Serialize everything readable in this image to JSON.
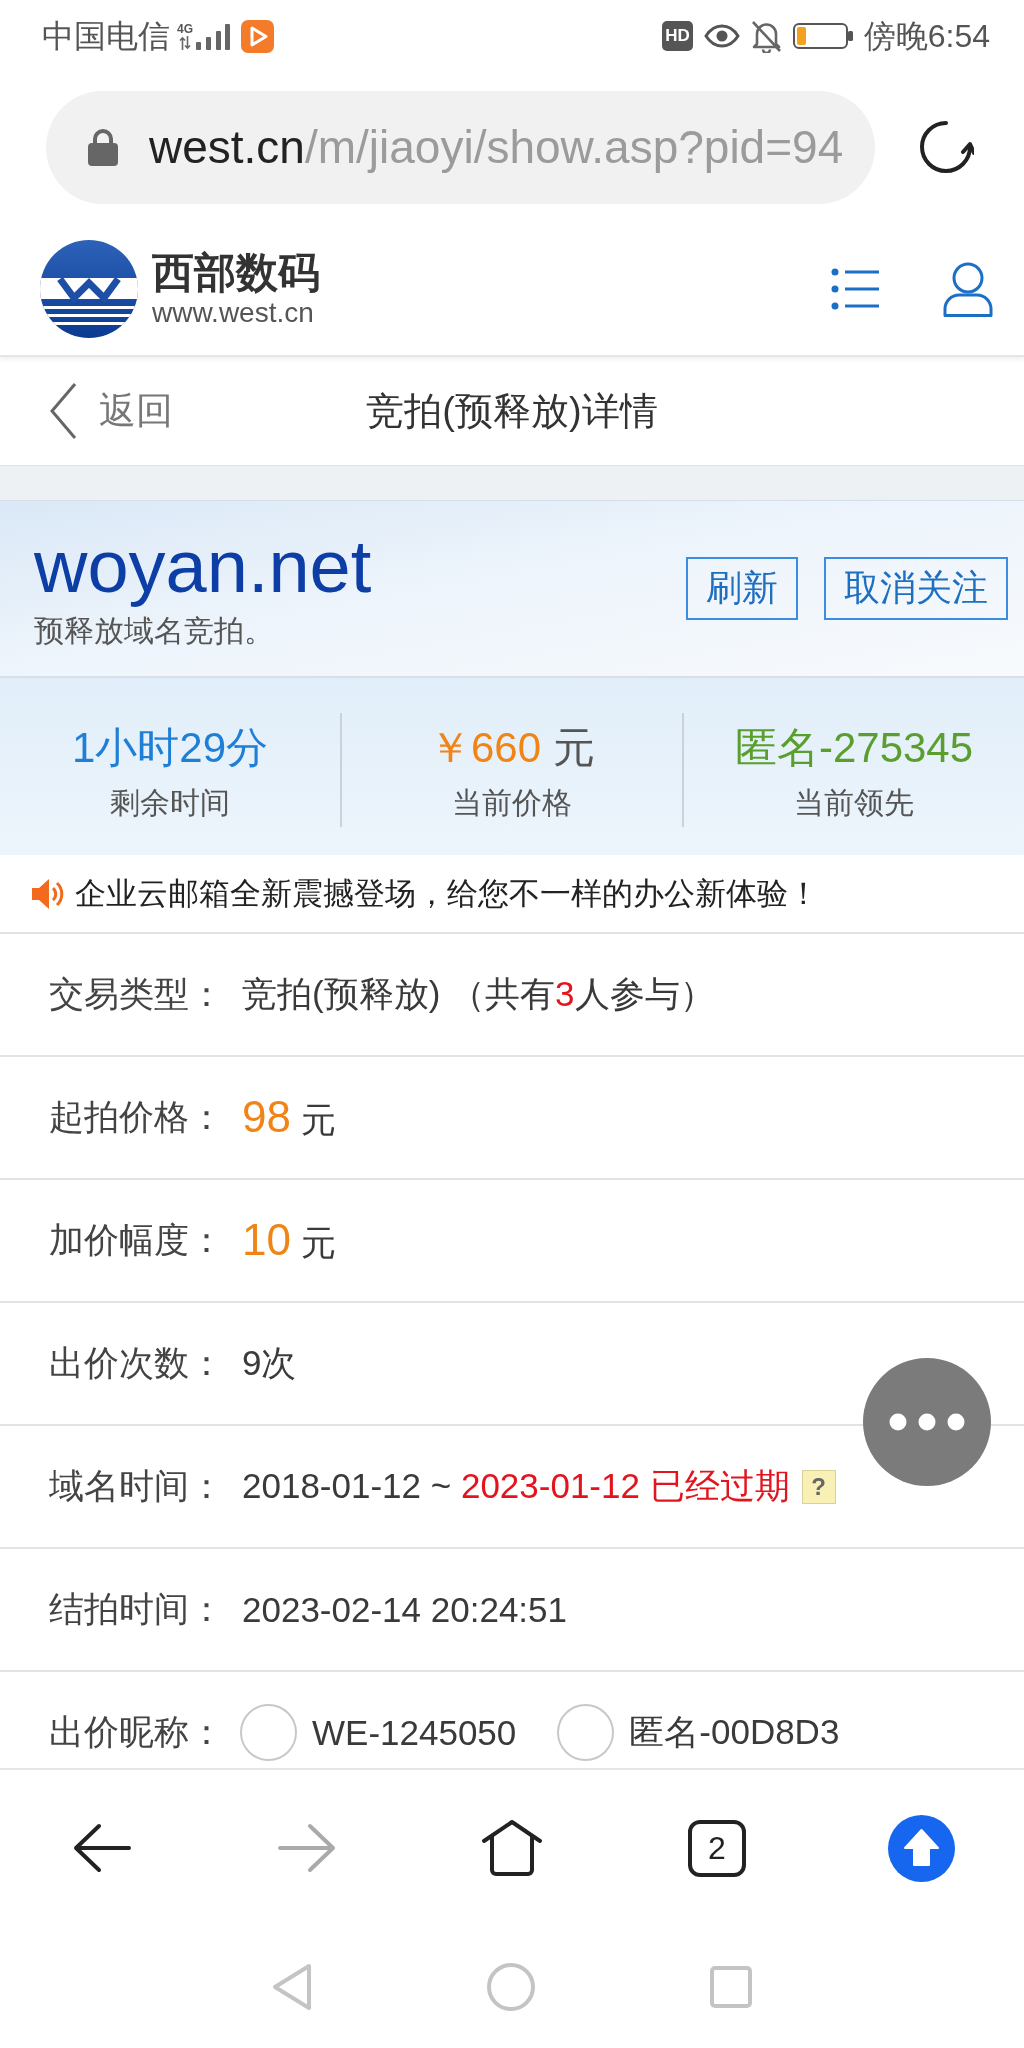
{
  "status_bar": {
    "carrier": "中国电信",
    "network": "4G",
    "hd_badge": "HD",
    "time": "傍晚6:54"
  },
  "address_bar": {
    "host": "west.cn",
    "path": "/m/jiaoyi/show.asp?pid=94"
  },
  "site_header": {
    "brand": "西部数码",
    "url": "www.west.cn"
  },
  "page_nav": {
    "back": "返回",
    "title": "竞拍(预释放)详情"
  },
  "domain_card": {
    "domain": "woyan.net",
    "subtitle": "预释放域名竞拍。",
    "buttons": [
      "刷新",
      "取消关注"
    ]
  },
  "stats": [
    {
      "value": "1小时29分",
      "label": "剩余时间",
      "color": "#1f7fd6"
    },
    {
      "value": "￥660",
      "unit": "元",
      "label": "当前价格",
      "color": "#f08417"
    },
    {
      "value": "匿名-275345",
      "label": "当前领先",
      "color": "#5a9e2e"
    }
  ],
  "notice": "企业云邮箱全新震撼登场，给您不一样的办公新体验！",
  "details": [
    {
      "kind": "text",
      "label": "交易类型：",
      "value": [
        {
          "text": "竞拍(预释放) （共有",
          "highlighted": false
        },
        {
          "text": "3",
          "highlighted": true
        },
        {
          "text": "人参与）",
          "highlighted": false
        }
      ]
    },
    {
      "kind": "price",
      "label": "起拍价格：",
      "amount": "98",
      "unit": "元"
    },
    {
      "kind": "price",
      "label": "加价幅度：",
      "amount": "10",
      "unit": "元"
    },
    {
      "kind": "text",
      "label": "出价次数：",
      "value": [
        {
          "text": "9次",
          "highlighted": false
        }
      ]
    },
    {
      "kind": "text",
      "label": "域名时间：",
      "value": [
        {
          "text": "2018-01-12 ~ ",
          "highlighted": false
        },
        {
          "text": "2023-01-12 已经过期",
          "highlighted": true
        }
      ],
      "help": "?"
    },
    {
      "kind": "text",
      "label": "结拍时间：",
      "value": [
        {
          "text": "2023-02-14 20:24:51",
          "highlighted": false
        }
      ]
    },
    {
      "kind": "radio",
      "label": "出价昵称：",
      "options": [
        {
          "label": "WE-1245050",
          "selected": false
        },
        {
          "label": "匿名-00D8D3",
          "selected": false
        }
      ]
    }
  ],
  "browser_toolbar": {
    "back": {
      "disabled": false
    },
    "forward": {
      "disabled": true
    },
    "tab_count": "2"
  }
}
